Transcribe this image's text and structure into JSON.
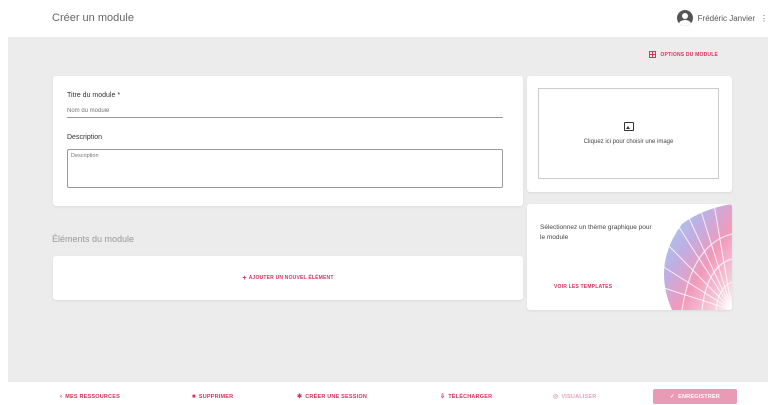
{
  "header": {
    "page_title": "Créer un module",
    "user_name": "Frédéric Janvier"
  },
  "options": {
    "label": "OPTIONS DU MODULE"
  },
  "form": {
    "title_label": "Titre du module *",
    "title_placeholder": "Nom du module",
    "description_label": "Description",
    "description_placeholder": "Description"
  },
  "image_upload": {
    "text": "Cliquez ici pour choisir une image"
  },
  "elements": {
    "section_label": "Éléments du module",
    "add_label": "AJOUTER UN NOUVEL ÉLÉMENT"
  },
  "theme": {
    "text": "Sélectionnez un thème graphique pour le module",
    "link_label": "VOIR LES TEMPLATES"
  },
  "footer": {
    "my_resources": "MES RESSOURCES",
    "delete": "SUPPRIMER",
    "create_session": "CRÉER UNE SESSION",
    "download": "TÉLÉCHARGER",
    "preview": "VISUALISER",
    "save": "ENREGISTRER"
  },
  "colors": {
    "accent": "#d9325c",
    "accent_muted": "#e99ab5",
    "background": "#ececec"
  }
}
